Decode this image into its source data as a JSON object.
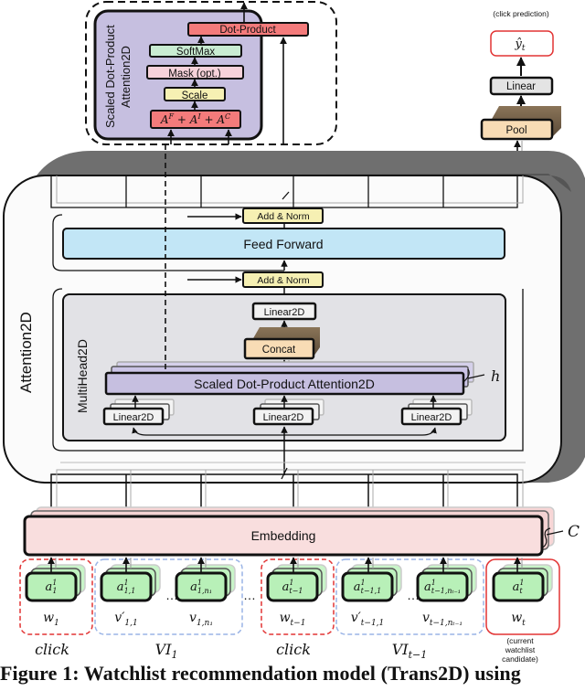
{
  "scaled_dot_product_inset": {
    "title_line1": "Scaled Dot-Product",
    "title_line2": "Attention2D",
    "blocks": {
      "dot_product": "Dot-Product",
      "softmax": "SoftMax",
      "mask": "Mask (opt.)",
      "scale": "Scale",
      "sum_term_1": "A",
      "sum_sup_1": "F",
      "sum_term_2": "A",
      "sum_sup_2": "I",
      "sum_term_3": "A",
      "sum_sup_3": "C",
      "plus": "+"
    }
  },
  "output_head": {
    "annotation": "(click prediction)",
    "output_symbol": "ŷ",
    "output_subscript": "t",
    "linear": "Linear",
    "pool": "Pool"
  },
  "attention2d": {
    "label": "Attention2D",
    "add_norm_top": "Add & Norm",
    "feed_forward": "Feed Forward",
    "add_norm_bottom": "Add & Norm",
    "multihead": {
      "label": "MultiHead2D",
      "linear_top": "Linear2D",
      "concat": "Concat",
      "sdpa": "Scaled Dot-Product Attention2D",
      "heads_symbol": "h",
      "linear_inputs": [
        "Linear2D",
        "Linear2D",
        "Linear2D"
      ]
    }
  },
  "embedding": {
    "label": "Embedding",
    "channels_symbol": "C"
  },
  "inputs": {
    "items": [
      {
        "node": "a",
        "node_sup": "1",
        "node_sub": "1",
        "label": "w",
        "label_sub": "1",
        "prime": ""
      },
      {
        "node": "a",
        "node_sup": "1",
        "node_sub": "1,1",
        "label": "v",
        "label_sub": "1,1",
        "prime": "′"
      },
      {
        "node": "a",
        "node_sup": "1",
        "node_sub": "1,n₁",
        "label": "v",
        "label_sub": "1,n₁",
        "prime": ""
      },
      {
        "node": "a",
        "node_sup": "1",
        "node_sub": "t−1",
        "label": "w",
        "label_sub": "t−1",
        "prime": ""
      },
      {
        "node": "a",
        "node_sup": "1",
        "node_sub": "t−1,1",
        "label": "v",
        "label_sub": "t−1,1",
        "prime": "′"
      },
      {
        "node": "a",
        "node_sup": "1",
        "node_sub": "t−1,nₜ₋₁",
        "label": "v",
        "label_sub": "t−1,nₜ₋₁",
        "prime": ""
      },
      {
        "node": "a",
        "node_sup": "1",
        "node_sub": "t",
        "label": "w",
        "label_sub": "t",
        "prime": ""
      }
    ],
    "ellipsis": "…",
    "group_labels": [
      {
        "text": "click",
        "sub": ""
      },
      {
        "text": "VI",
        "sub": "1"
      },
      {
        "text": "click",
        "sub": ""
      },
      {
        "text": "VI",
        "sub": "t−1"
      }
    ],
    "candidate_note": [
      "(current",
      "watchlist",
      "candidate)"
    ]
  },
  "colors": {
    "dot_product": "#f47b7b",
    "softmax": "#c9ecd2",
    "mask": "#f7d2da",
    "scale": "#f6f0b3",
    "inset_bg": "#c6bfe0",
    "feed_forward": "#c2e6f6",
    "add_norm": "#f6f0b3",
    "sdpa": "#c6bfe0",
    "concat": "#f8dcb5",
    "pool": "#f8dcb5",
    "embedding": "#f9dede",
    "input_node": "#b8f0b8",
    "click_group": "#e23333",
    "vi_group": "#9ab4e6",
    "candidate_group": "#e23333"
  },
  "caption": "Figure 1: Watchlist recommendation model (Trans2D) using"
}
